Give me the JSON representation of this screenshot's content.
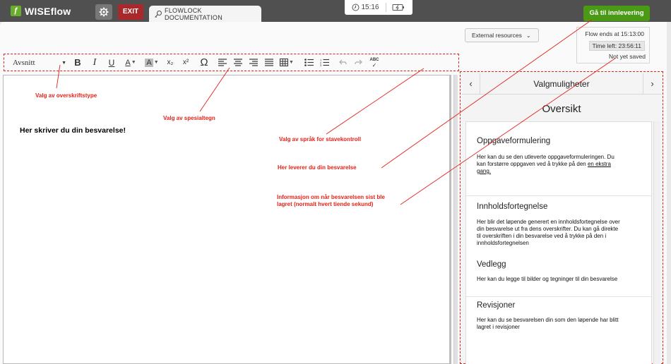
{
  "header": {
    "logo_text": "WISEflow",
    "exit_label": "EXIT",
    "tab_label": "FLOWLOCK DOCUMENTATION",
    "clock_time": "15:16",
    "submit_label": "Gå til innlevering"
  },
  "top_right": {
    "external_resources": "External resources",
    "flow_ends": "Flow ends at 15:13:00",
    "time_left": "Time left: 23:56:11",
    "save_status": "Not yet saved"
  },
  "toolbar": {
    "paragraph_style": "Avsnitt",
    "bold": "B",
    "italic": "I",
    "underline": "U",
    "font_color": "A",
    "highlight": "A",
    "subscript": "x₂",
    "superscript": "x²",
    "special_char": "Ω",
    "spellcheck": "ABC"
  },
  "editor": {
    "content": "Her skriver du din besvarelse!"
  },
  "panel": {
    "title": "Valgmuligheter",
    "subtitle": "Oversikt",
    "sections": [
      {
        "title": "Oppgaveformulering",
        "body": "Her kan du se den utleverte oppgaveformuleringen. Du kan forstørre oppgaven ved å trykke på den ",
        "link": "en ekstra gang."
      },
      {
        "title": "Innholdsfortegnelse",
        "body": "Her blir det løpende generert en innholdsfortegnelse over din besvarelse ut fra dens overskrifter. Du kan gå direkte til overskriften i din besvarelse ved å trykke på den i innholdsfortegnelsen"
      },
      {
        "title": "Vedlegg",
        "body": "Her kan du legge til bilder og tegninger til din besvarelse"
      },
      {
        "title": "Revisjoner",
        "body": "Her kan du se besvarelsen din som den løpende har blitt lagret i revisjoner"
      }
    ]
  },
  "annotations": {
    "heading_type": "Valg av overskriftstype",
    "special_chars": "Valg av spesialtegn",
    "spellcheck_language": "Valg av språk for stavekontroll",
    "submit": "Her leverer du din besvarelse",
    "save_info": "Informasjon om når besvarelsen sist ble lagret (normalt hvert tiende sekund)"
  },
  "colors": {
    "topbar": "#505050",
    "exit": "#a8282b",
    "submit": "#4a9a16",
    "annotation": "#e2231a",
    "logo": "#6aac2b"
  }
}
